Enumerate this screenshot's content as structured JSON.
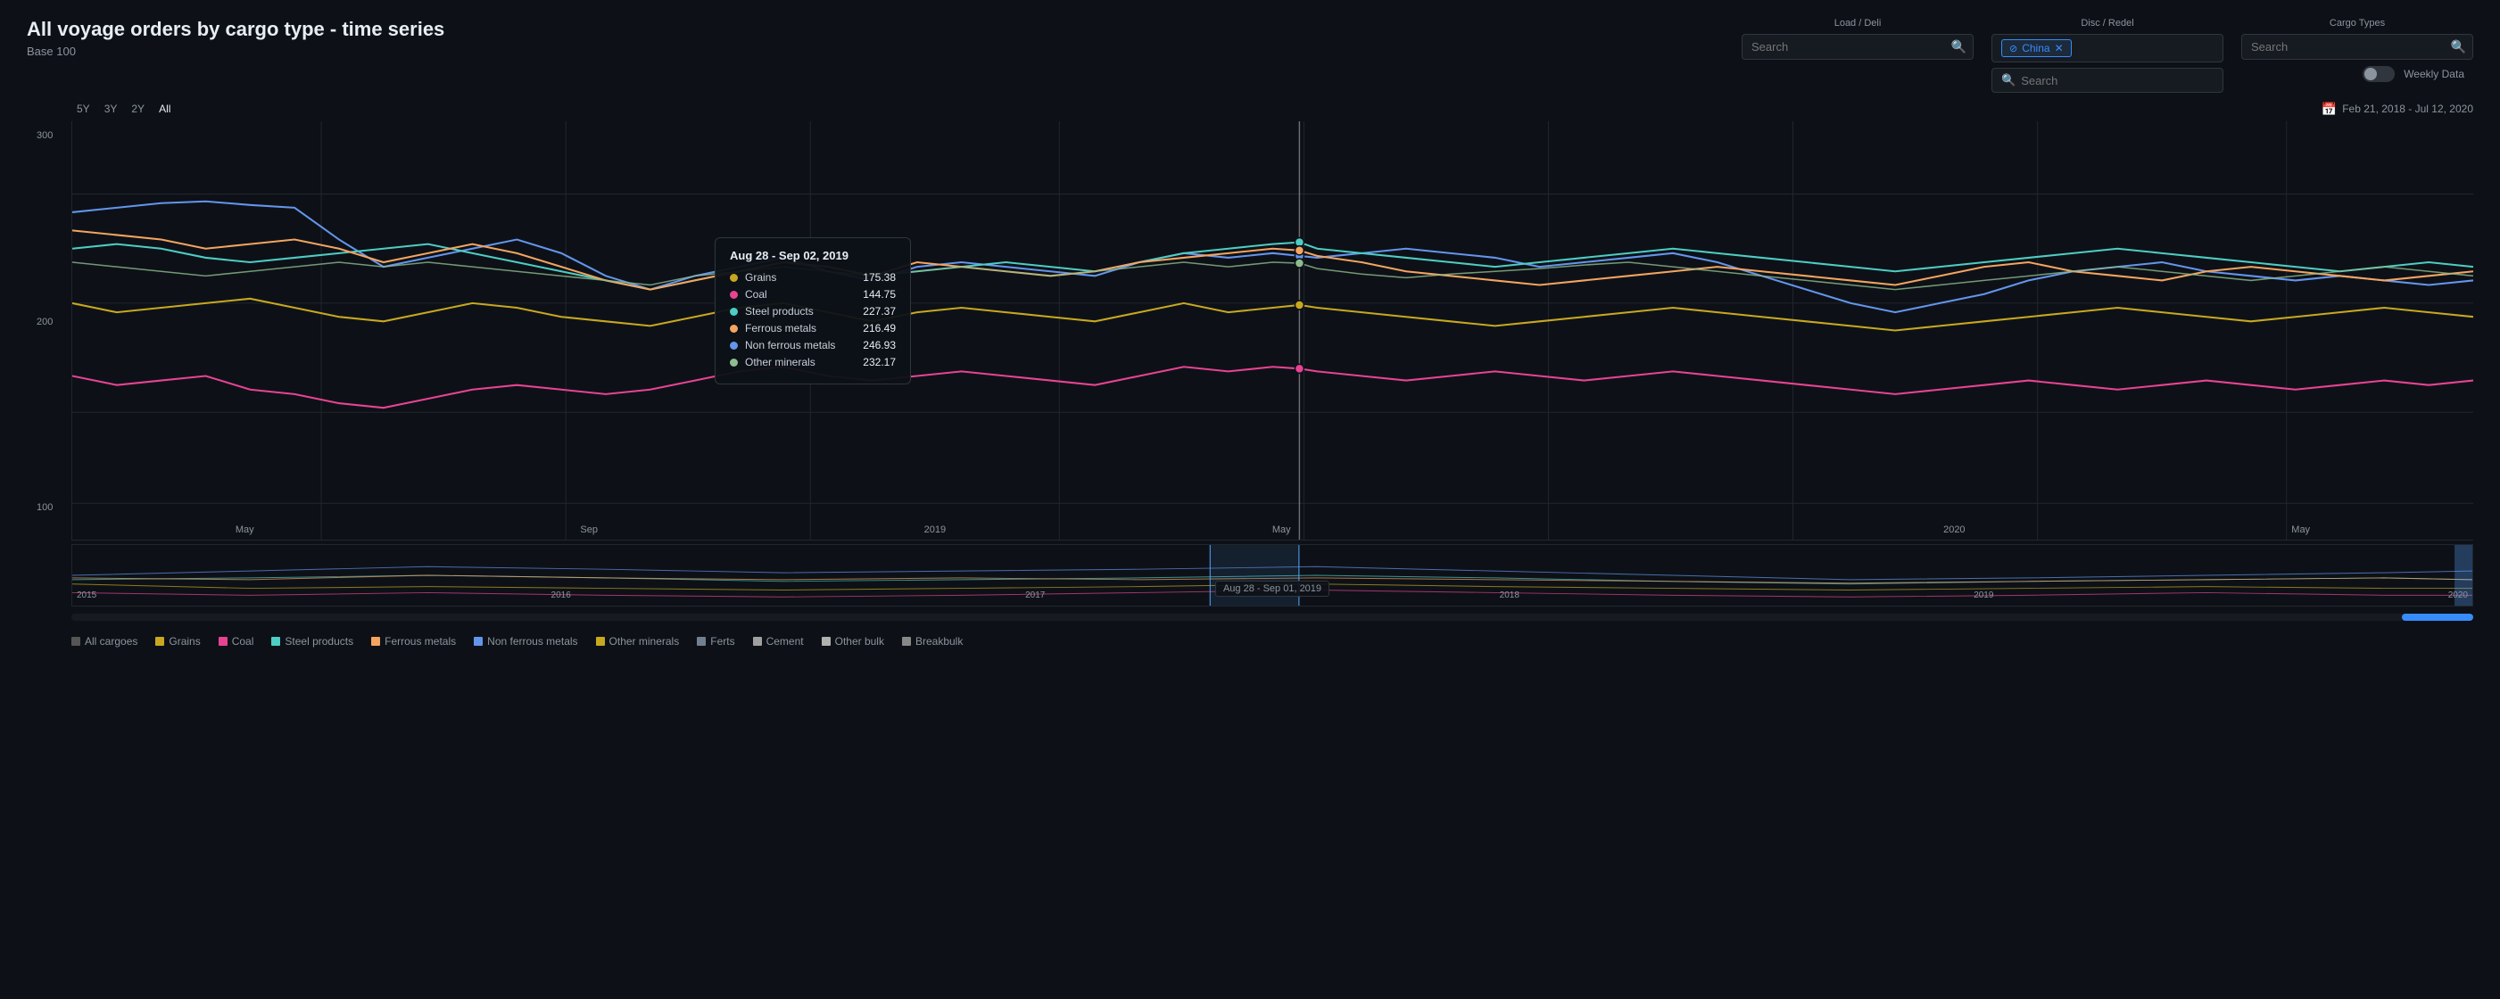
{
  "page": {
    "title": "All voyage orders by cargo type - time series",
    "subtitle": "Base 100"
  },
  "header": {
    "load_deli_label": "Load / Deli",
    "disc_redel_label": "Disc / Redel",
    "cargo_types_label": "Cargo Types",
    "load_search_placeholder": "Search",
    "disc_search_placeholder": "Search",
    "cargo_search_placeholder": "Search",
    "china_filter_label": "China",
    "china_sub_search_placeholder": "Search"
  },
  "controls": {
    "weekly_data_label": "Weekly Data",
    "time_buttons": [
      "5Y",
      "3Y",
      "2Y",
      "All"
    ],
    "active_time": "All",
    "date_range": "Feb 21, 2018 - Jul 12, 2020"
  },
  "chart": {
    "y_labels": [
      "300",
      "200",
      "100"
    ],
    "x_labels": [
      "May",
      "Sep",
      "2019",
      "May",
      "",
      "2020",
      "May"
    ],
    "mini_x_labels": [
      "2015",
      "2016",
      "2017",
      "2018",
      "2019",
      "2020"
    ],
    "vertical_line_label": "Aug 28 - Sep 01, 2019"
  },
  "tooltip": {
    "title": "Aug 28 - Sep 02, 2019",
    "rows": [
      {
        "name": "Grains",
        "value": "175.38",
        "color": "#c8a820"
      },
      {
        "name": "Coal",
        "value": "144.75",
        "color": "#e84393"
      },
      {
        "name": "Steel products",
        "value": "227.37",
        "color": "#4ecdc4"
      },
      {
        "name": "Ferrous metals",
        "value": "216.49",
        "color": "#f4a460"
      },
      {
        "name": "Non ferrous metals",
        "value": "246.93",
        "color": "#6495ed"
      },
      {
        "name": "Other minerals",
        "value": "232.17",
        "color": "#556b2f"
      }
    ]
  },
  "legend": {
    "items": [
      {
        "label": "All cargoes",
        "color": "#555555"
      },
      {
        "label": "Grains",
        "color": "#c8a820"
      },
      {
        "label": "Coal",
        "color": "#e84393"
      },
      {
        "label": "Steel products",
        "color": "#4ecdc4"
      },
      {
        "label": "Ferrous metals",
        "color": "#f4a460"
      },
      {
        "label": "Non ferrous metals",
        "color": "#6495ed"
      },
      {
        "label": "Other minerals",
        "color": "#c8a820"
      },
      {
        "label": "Ferts",
        "color": "#708090"
      },
      {
        "label": "Cement",
        "color": "#a0a0a0"
      },
      {
        "label": "Other bulk",
        "color": "#b0b0b0"
      },
      {
        "label": "Breakbulk",
        "color": "#888888"
      }
    ]
  },
  "chart_lines": {
    "description": "Multi-line time series chart showing voyage orders by cargo type indexed to base 100",
    "lines": [
      {
        "id": "non_ferrous",
        "color": "#6495ed",
        "opacity": 0.9
      },
      {
        "id": "steel_products",
        "color": "#4ecdc4",
        "opacity": 0.9
      },
      {
        "id": "ferrous_metals",
        "color": "#f4a460",
        "opacity": 0.9
      },
      {
        "id": "other_minerals",
        "color": "#556b2f",
        "opacity": 0.9
      },
      {
        "id": "grains",
        "color": "#c8a820",
        "opacity": 0.9
      },
      {
        "id": "coal",
        "color": "#e84393",
        "opacity": 0.9
      }
    ]
  }
}
